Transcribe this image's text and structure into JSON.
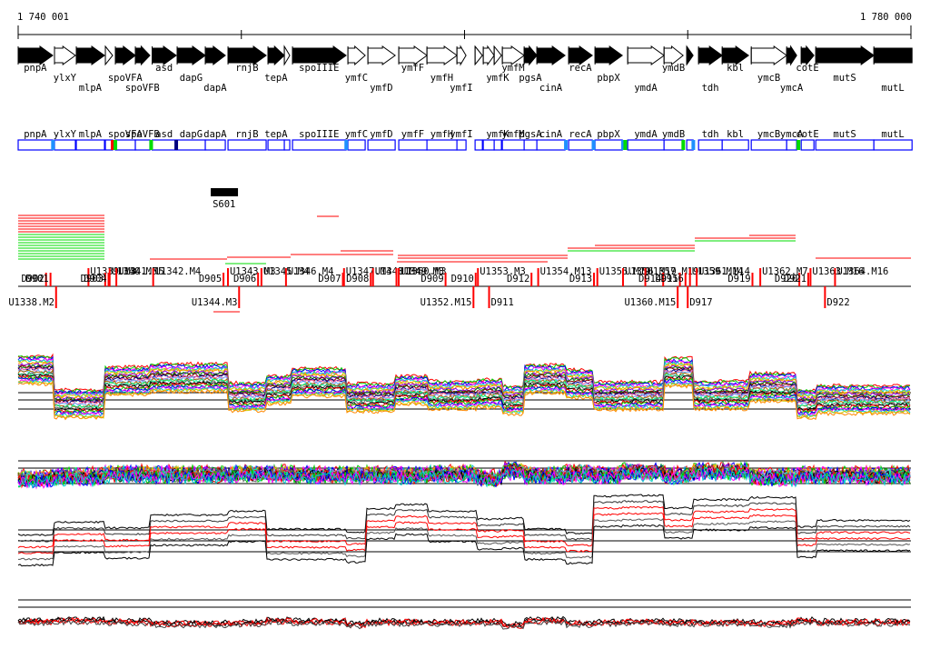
{
  "axis": {
    "start": 1740001,
    "end": 1780000,
    "start_label": "1 740 001",
    "end_label": "1 780 000"
  },
  "genes": [
    {
      "name": "pnpA",
      "start": 1740001,
      "end": 1741548,
      "filled": true,
      "level": 0
    },
    {
      "name": "ylxY",
      "start": 1741629,
      "end": 1742565,
      "filled": false,
      "level": 1
    },
    {
      "name": "mlpA",
      "start": 1742606,
      "end": 1743868,
      "filled": true,
      "level": 2
    },
    {
      "name": "",
      "start": 1743908,
      "end": 1744234,
      "filled": false,
      "level": 0
    },
    {
      "name": "spoVFA",
      "start": 1744356,
      "end": 1745251,
      "filled": true,
      "level": 1
    },
    {
      "name": "spoVFB",
      "start": 1745251,
      "end": 1745903,
      "filled": true,
      "level": 2
    },
    {
      "name": "asd",
      "start": 1746003,
      "end": 1747083,
      "filled": true,
      "level": 0
    },
    {
      "name": "dapG",
      "start": 1747124,
      "end": 1748385,
      "filled": true,
      "level": 1
    },
    {
      "name": "dapA",
      "start": 1748385,
      "end": 1749281,
      "filled": true,
      "level": 2
    },
    {
      "name": "rnjB",
      "start": 1749403,
      "end": 1751112,
      "filled": true,
      "level": 0
    },
    {
      "name": "tepA",
      "start": 1751194,
      "end": 1751926,
      "filled": true,
      "level": 1
    },
    {
      "name": "",
      "start": 1751926,
      "end": 1752170,
      "filled": false,
      "level": 0
    },
    {
      "name": "spoIIIE",
      "start": 1752292,
      "end": 1754694,
      "filled": true,
      "level": 0
    },
    {
      "name": "ymfC",
      "start": 1754775,
      "end": 1755548,
      "filled": false,
      "level": 1
    },
    {
      "name": "ymfD",
      "start": 1755671,
      "end": 1756892,
      "filled": false,
      "level": 2
    },
    {
      "name": "ymfF",
      "start": 1757054,
      "end": 1758316,
      "filled": false,
      "level": 0
    },
    {
      "name": "ymfH",
      "start": 1758316,
      "end": 1759659,
      "filled": false,
      "level": 1
    },
    {
      "name": "ymfI",
      "start": 1759659,
      "end": 1760066,
      "filled": false,
      "level": 2
    },
    {
      "name": "",
      "start": 1760473,
      "end": 1760800,
      "filled": false,
      "level": 0
    },
    {
      "name": "",
      "start": 1760839,
      "end": 1761328,
      "filled": false,
      "level": 0
    },
    {
      "name": "ymfK",
      "start": 1761328,
      "end": 1761653,
      "filled": false,
      "level": 1
    },
    {
      "name": "ymfM",
      "start": 1761694,
      "end": 1762671,
      "filled": false,
      "level": 0
    },
    {
      "name": "pgsA",
      "start": 1762671,
      "end": 1763241,
      "filled": true,
      "level": 1
    },
    {
      "name": "cinA",
      "start": 1763241,
      "end": 1764502,
      "filled": true,
      "level": 2
    },
    {
      "name": "recA",
      "start": 1764665,
      "end": 1765723,
      "filled": true,
      "level": 0
    },
    {
      "name": "pbpX",
      "start": 1765846,
      "end": 1767067,
      "filled": true,
      "level": 1
    },
    {
      "name": "ymdA",
      "start": 1767311,
      "end": 1768939,
      "filled": false,
      "level": 2
    },
    {
      "name": "ymdB",
      "start": 1768939,
      "end": 1769793,
      "filled": false,
      "level": 0
    },
    {
      "name": "",
      "start": 1769956,
      "end": 1770241,
      "filled": true,
      "level": 0
    },
    {
      "name": "tdh",
      "start": 1770485,
      "end": 1771544,
      "filled": true,
      "level": 2
    },
    {
      "name": "kbl",
      "start": 1771544,
      "end": 1772724,
      "filled": true,
      "level": 0
    },
    {
      "name": "ymcB",
      "start": 1772846,
      "end": 1774433,
      "filled": false,
      "level": 1
    },
    {
      "name": "ymcA",
      "start": 1774433,
      "end": 1774881,
      "filled": true,
      "level": 2
    },
    {
      "name": "cotE",
      "start": 1775084,
      "end": 1775654,
      "filled": true,
      "level": 0
    },
    {
      "name": "mutS",
      "start": 1775736,
      "end": 1778340,
      "filled": true,
      "level": 1
    },
    {
      "name": "mutL",
      "start": 1778340,
      "end": 1780050,
      "filled": true,
      "level": 2,
      "noarrow": true
    }
  ],
  "markers": [
    {
      "pos": 1741560,
      "color": "#1e90ff"
    },
    {
      "pos": 1744234,
      "color": "#ff0000"
    },
    {
      "pos": 1744356,
      "color": "#00dd00"
    },
    {
      "pos": 1745960,
      "color": "#00dd00"
    },
    {
      "pos": 1747083,
      "color": "#000080"
    },
    {
      "pos": 1754700,
      "color": "#1e90ff"
    },
    {
      "pos": 1764540,
      "color": "#1e90ff"
    },
    {
      "pos": 1765780,
      "color": "#1e90ff"
    },
    {
      "pos": 1767100,
      "color": "#1e90ff"
    },
    {
      "pos": 1767200,
      "color": "#00dd00"
    },
    {
      "pos": 1769800,
      "color": "#00dd00"
    },
    {
      "pos": 1770250,
      "color": "#1e90ff"
    },
    {
      "pos": 1774960,
      "color": "#00dd00"
    }
  ],
  "feature": {
    "label": "S601",
    "start": 1748630,
    "end": 1749850
  },
  "sites": [
    {
      "label": "D902",
      "pos": 1741250,
      "row": 0
    },
    {
      "label": "D901",
      "pos": 1741450,
      "row": 0
    },
    {
      "label": "U1338.M2",
      "pos": 1741700,
      "row": 1
    },
    {
      "label": "U1339.M3",
      "pos": 1743150,
      "row": -1
    },
    {
      "label": "D903",
      "pos": 1743900,
      "row": 0
    },
    {
      "label": "D904",
      "pos": 1744050,
      "row": 0
    },
    {
      "label": "U1340.M5",
      "pos": 1744100,
      "row": -1
    },
    {
      "label": "U1341.M5",
      "pos": 1744400,
      "row": -1
    },
    {
      "label": "U1342.M4",
      "pos": 1746050,
      "row": -1
    },
    {
      "label": "D905",
      "pos": 1749200,
      "row": 0
    },
    {
      "label": "U1343.M3",
      "pos": 1749400,
      "row": -1
    },
    {
      "label": "U1344.M3",
      "pos": 1749900,
      "row": 1
    },
    {
      "label": "D906",
      "pos": 1750750,
      "row": 0
    },
    {
      "label": "U1345.M4",
      "pos": 1750900,
      "row": -1
    },
    {
      "label": "U1346.M4",
      "pos": 1752000,
      "row": -1
    },
    {
      "label": "D907",
      "pos": 1754550,
      "row": 0
    },
    {
      "label": "U1347.M4",
      "pos": 1754600,
      "row": -1
    },
    {
      "label": "D908",
      "pos": 1755800,
      "row": 0
    },
    {
      "label": "U1348.M4",
      "pos": 1755900,
      "row": -1
    },
    {
      "label": "U1349.M3",
      "pos": 1756950,
      "row": -1
    },
    {
      "label": "U1350.M3",
      "pos": 1757050,
      "row": -1
    },
    {
      "label": "D909",
      "pos": 1759150,
      "row": 0
    },
    {
      "label": "U1352.M15",
      "pos": 1760400,
      "row": 1
    },
    {
      "label": "D910",
      "pos": 1760500,
      "row": 0
    },
    {
      "label": "D911",
      "pos": 1761100,
      "row": 1
    },
    {
      "label": "U1353.M3",
      "pos": 1760600,
      "row": -1
    },
    {
      "label": "D912",
      "pos": 1763000,
      "row": 0
    },
    {
      "label": "U1354.M13",
      "pos": 1763300,
      "row": -1
    },
    {
      "label": "D913",
      "pos": 1765800,
      "row": 0
    },
    {
      "label": "U1355.M19",
      "pos": 1765950,
      "row": -1
    },
    {
      "label": "U1356.M19",
      "pos": 1767100,
      "row": -1
    },
    {
      "label": "U1357.M19",
      "pos": 1768100,
      "row": -1
    },
    {
      "label": "D914",
      "pos": 1768900,
      "row": 0
    },
    {
      "label": "U1360.M15",
      "pos": 1769550,
      "row": 1
    },
    {
      "label": "D915",
      "pos": 1769650,
      "row": 0
    },
    {
      "label": "D916",
      "pos": 1769900,
      "row": 0
    },
    {
      "label": "D917",
      "pos": 1770000,
      "row": 1
    },
    {
      "label": "U1359.M14",
      "pos": 1770100,
      "row": -1
    },
    {
      "label": "U1361.M14",
      "pos": 1770400,
      "row": -1
    },
    {
      "label": "D919",
      "pos": 1772900,
      "row": 0
    },
    {
      "label": "U1362.M7",
      "pos": 1773250,
      "row": -1
    },
    {
      "label": "D920",
      "pos": 1775000,
      "row": 0
    },
    {
      "label": "D921",
      "pos": 1775400,
      "row": 0
    },
    {
      "label": "U1363.M16",
      "pos": 1775500,
      "row": -1
    },
    {
      "label": "U1364.M16",
      "pos": 1776600,
      "row": -1
    },
    {
      "label": "D922",
      "pos": 1776150,
      "row": 1
    }
  ],
  "colors": {
    "box": "#0000ff",
    "site": "#ff0000",
    "green": "#00dd00"
  }
}
